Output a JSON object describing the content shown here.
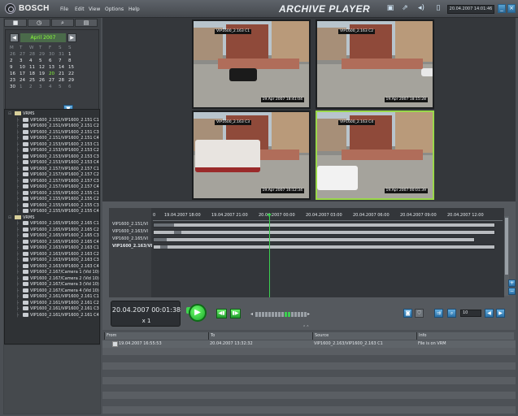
{
  "title_bar": {
    "brand": "BOSCH",
    "menu": [
      "File",
      "Edit",
      "View",
      "Options",
      "Help"
    ],
    "app_title": "ARCHIVE PLAYER",
    "datetime": "20.04.2007 14:01:46",
    "icons": [
      "monitor-icon",
      "export-icon",
      "speaker-icon",
      "battery-icon"
    ],
    "window_buttons": [
      "minimize",
      "close"
    ]
  },
  "left_panel": {
    "tabs": [
      "camera-tab-icon",
      "clock-tab-icon",
      "search-tab-icon",
      "bookmark-tab-icon"
    ],
    "calendar": {
      "month": "April 2007",
      "weekdays": [
        "M",
        "T",
        "W",
        "T",
        "F",
        "S",
        "S"
      ],
      "weeks": [
        [
          "26",
          "27",
          "28",
          "29",
          "30",
          "31",
          "1"
        ],
        [
          "2",
          "3",
          "4",
          "5",
          "6",
          "7",
          "8"
        ],
        [
          "9",
          "10",
          "11",
          "12",
          "13",
          "14",
          "15"
        ],
        [
          "16",
          "17",
          "18",
          "19",
          "20",
          "21",
          "22"
        ],
        [
          "23",
          "24",
          "25",
          "26",
          "27",
          "28",
          "29"
        ],
        [
          "30",
          "1",
          "2",
          "3",
          "4",
          "5",
          "6"
        ]
      ],
      "selected_day": "20"
    },
    "tree": [
      {
        "label": "VRMS",
        "type": "folder",
        "depth": 0
      },
      {
        "label": "VIP1600_2.151/VIP1600_2.151 C1",
        "type": "item",
        "depth": 1
      },
      {
        "label": "VIP1600_2.151/VIP1600_2.151 C2",
        "type": "item",
        "depth": 1
      },
      {
        "label": "VIP1600_2.151/VIP1600_2.151 C3",
        "type": "item",
        "depth": 1
      },
      {
        "label": "VIP1600_2.151/VIP1600_2.151 C4",
        "type": "item",
        "depth": 1
      },
      {
        "label": "VIP1600_2.153/VIP1600_2.153 C1",
        "type": "item",
        "depth": 1
      },
      {
        "label": "VIP1600_2.153/VIP1600_2.153 C2",
        "type": "item",
        "depth": 1
      },
      {
        "label": "VIP1600_2.153/VIP1600_2.153 C3",
        "type": "item",
        "depth": 1
      },
      {
        "label": "VIP1600_2.153/VIP1600_2.153 C4",
        "type": "item",
        "depth": 1
      },
      {
        "label": "VIP1600_2.157/VIP1600_2.157 C1",
        "type": "item",
        "depth": 1
      },
      {
        "label": "VIP1600_2.157/VIP1600_2.157 C2",
        "type": "item",
        "depth": 1
      },
      {
        "label": "VIP1600_2.157/VIP1600_2.157 C3",
        "type": "item",
        "depth": 1
      },
      {
        "label": "VIP1600_2.157/VIP1600_2.157 C4",
        "type": "item",
        "depth": 1
      },
      {
        "label": "VIP1600_2.155/VIP1600_2.155 C1",
        "type": "item",
        "depth": 1
      },
      {
        "label": "VIP1600_2.155/VIP1600_2.155 C2",
        "type": "item",
        "depth": 1
      },
      {
        "label": "VIP1600_2.155/VIP1600_2.155 C3",
        "type": "item",
        "depth": 1
      },
      {
        "label": "VIP1600_2.155/VIP1600_2.155 C4",
        "type": "item",
        "depth": 1
      },
      {
        "label": "VRMS",
        "type": "folder",
        "depth": 0
      },
      {
        "label": "VIP1600_2.165/VIP1600_2.165 C1",
        "type": "item",
        "depth": 1
      },
      {
        "label": "VIP1600_2.165/VIP1600_2.165 C2",
        "type": "item",
        "depth": 1
      },
      {
        "label": "VIP1600_2.165/VIP1600_2.165 C3",
        "type": "item",
        "depth": 1
      },
      {
        "label": "VIP1600_2.165/VIP1600_2.165 C4",
        "type": "item",
        "depth": 1
      },
      {
        "label": "VIP1600_2.163/VIP1600_2.163 C1",
        "type": "item",
        "depth": 1
      },
      {
        "label": "VIP1600_2.163/VIP1600_2.163 C2",
        "type": "item",
        "depth": 1
      },
      {
        "label": "VIP1600_2.163/VIP1600_2.163 C3",
        "type": "item",
        "depth": 1
      },
      {
        "label": "VIP1600_2.163/VIP1600_2.163 C4",
        "type": "item",
        "depth": 1
      },
      {
        "label": "VIP1600_2.167/Camera 1 (Vid 10)",
        "type": "item",
        "depth": 1
      },
      {
        "label": "VIP1600_2.167/Camera 2 (Vid 10)",
        "type": "item",
        "depth": 1
      },
      {
        "label": "VIP1600_2.167/Camera 3 (Vid 10)",
        "type": "item",
        "depth": 1
      },
      {
        "label": "VIP1600_2.167/Camera 4 (Vid 10)",
        "type": "item",
        "depth": 1
      },
      {
        "label": "VIP1600_2.161/VIP1600_2.161 C1",
        "type": "item",
        "depth": 1
      },
      {
        "label": "VIP1600_2.161/VIP1600_2.161 C2",
        "type": "item",
        "depth": 1
      },
      {
        "label": "VIP1600_2.161/VIP1600_2.161 C3",
        "type": "item",
        "depth": 1
      },
      {
        "label": "VIP1600_2.161/VIP1600_2.161 C4",
        "type": "item",
        "depth": 1
      }
    ]
  },
  "video_tiles": [
    {
      "label": "VIP1600_2.163 C1",
      "stamp": "19.Apr 2007 18:41:04",
      "active": false
    },
    {
      "label": "VIP1600_2.163 C2",
      "stamp": "19.Apr 2007 18:15:28",
      "active": false
    },
    {
      "label": "VIP1600_2.163 C3",
      "stamp": "19.Apr 2007 16:12:34",
      "active": false
    },
    {
      "label": "VIP1600_2.163 C4",
      "stamp": "19.Apr 2007 00:01:39",
      "active": true
    }
  ],
  "timeline": {
    "ticks": [
      "0",
      "19.04.2007 18:00",
      "19.04.2007 21:00",
      "20.04.2007 00:00",
      "20.04.2007 03:00",
      "20.04.2007 06:00",
      "20.04.2007 09:00",
      "20.04.2007 12:00"
    ],
    "tracks": [
      {
        "name": "VIP1600_2.151/VI",
        "bold": false
      },
      {
        "name": "VIP1600_2.163/VI",
        "bold": false
      },
      {
        "name": "VIP1600_2.165/VI",
        "bold": false
      },
      {
        "name": "VIP1600_2.163/VI",
        "bold": true
      }
    ]
  },
  "playback": {
    "time": "20.04.2007 00:01:38",
    "speed": "x 1",
    "step_value": "10"
  },
  "results": {
    "columns": [
      "From",
      "To",
      "Source",
      "Info"
    ],
    "rows": [
      {
        "from": "19.04.2007 16:55:53",
        "to": "20.04.2007 13:32:32",
        "source": "VIP1600_2.163/VIP1600_2.163 C1",
        "info": "File is on VRM"
      }
    ],
    "empty_rows": 9
  }
}
